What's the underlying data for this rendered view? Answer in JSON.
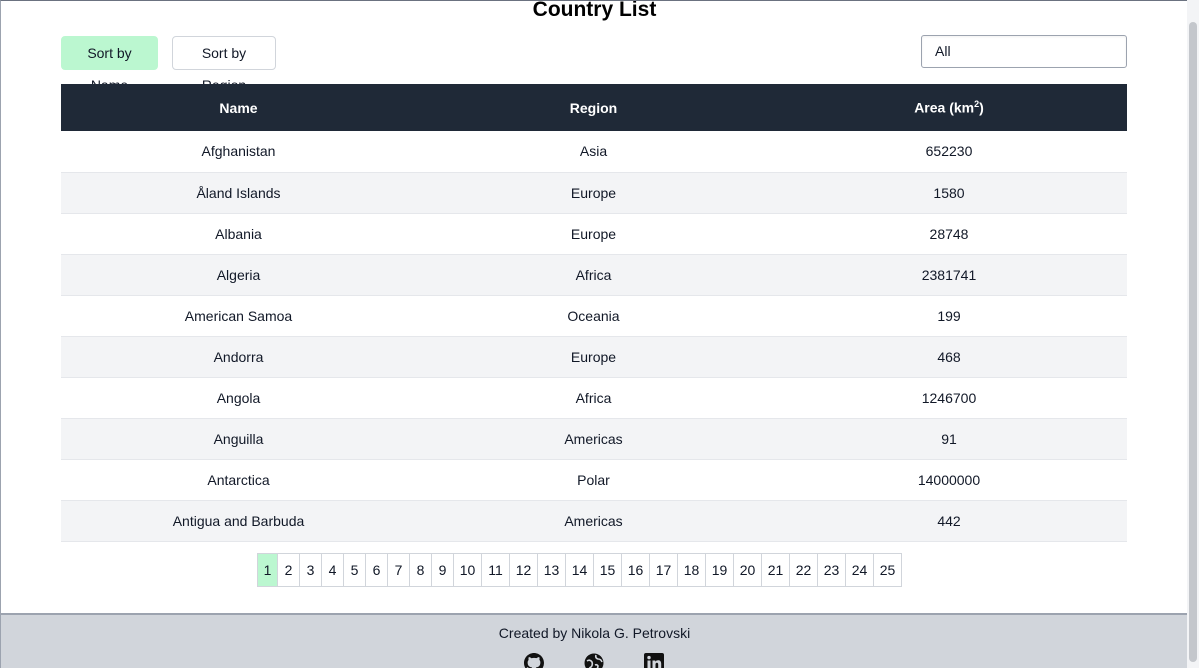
{
  "page": {
    "title": "Country List"
  },
  "controls": {
    "sort_by_name": "Sort by Name",
    "sort_by_region": "Sort by Region",
    "region_filter_value": "All"
  },
  "table": {
    "headers": {
      "name": "Name",
      "region": "Region",
      "area": "Area (km",
      "area_sup": "2",
      "area_close": ")"
    },
    "rows": [
      {
        "name": "Afghanistan",
        "region": "Asia",
        "area": "652230"
      },
      {
        "name": "Åland Islands",
        "region": "Europe",
        "area": "1580"
      },
      {
        "name": "Albania",
        "region": "Europe",
        "area": "28748"
      },
      {
        "name": "Algeria",
        "region": "Africa",
        "area": "2381741"
      },
      {
        "name": "American Samoa",
        "region": "Oceania",
        "area": "199"
      },
      {
        "name": "Andorra",
        "region": "Europe",
        "area": "468"
      },
      {
        "name": "Angola",
        "region": "Africa",
        "area": "1246700"
      },
      {
        "name": "Anguilla",
        "region": "Americas",
        "area": "91"
      },
      {
        "name": "Antarctica",
        "region": "Polar",
        "area": "14000000"
      },
      {
        "name": "Antigua and Barbuda",
        "region": "Americas",
        "area": "442"
      }
    ]
  },
  "pagination": {
    "current": "1",
    "pages": [
      "1",
      "2",
      "3",
      "4",
      "5",
      "6",
      "7",
      "8",
      "9",
      "10",
      "11",
      "12",
      "13",
      "14",
      "15",
      "16",
      "17",
      "18",
      "19",
      "20",
      "21",
      "22",
      "23",
      "24",
      "25"
    ]
  },
  "footer": {
    "credit": "Created by Nikola G. Petrovski",
    "icons": [
      "github-icon",
      "globe-icon",
      "linkedin-icon"
    ]
  },
  "colors": {
    "accent": "#bbf7d0",
    "header_bg": "#1f2937",
    "stripe": "#f3f4f6",
    "footer_bg": "#d1d5db"
  }
}
